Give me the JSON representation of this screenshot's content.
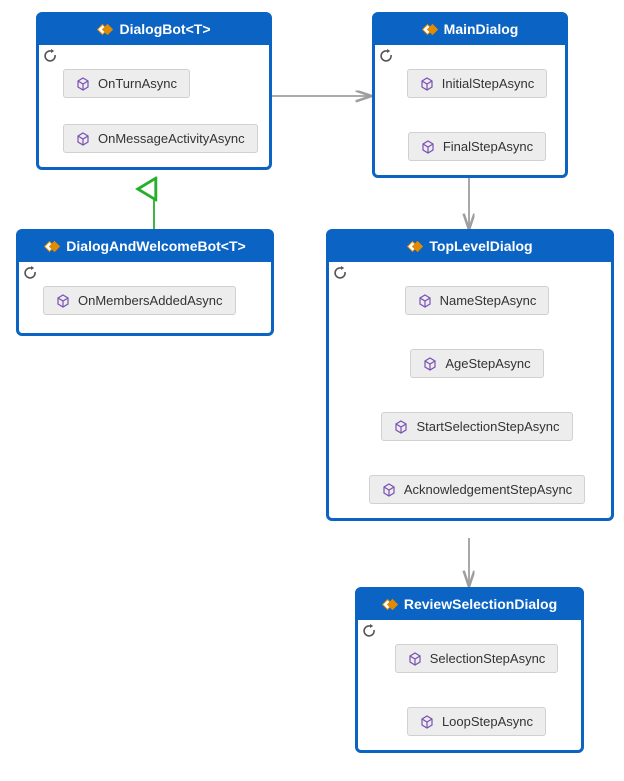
{
  "colors": {
    "primary": "#0b64c4",
    "method_bg": "#ededed",
    "method_border": "#d0d0d0",
    "arrow_gray": "#9e9e9e",
    "arrow_green": "#26b02a",
    "icon_orange": "#e38b00",
    "icon_purple": "#7a52b3"
  },
  "boxes": {
    "dialogBot": {
      "title": "DialogBot<T>",
      "methods": [
        "OnTurnAsync",
        "OnMessageActivityAsync"
      ]
    },
    "dialogAndWelcomeBot": {
      "title": "DialogAndWelcomeBot<T>",
      "methods": [
        "OnMembersAddedAsync"
      ]
    },
    "mainDialog": {
      "title": "MainDialog",
      "methods": [
        "InitialStepAsync",
        "FinalStepAsync"
      ]
    },
    "topLevelDialog": {
      "title": "TopLevelDialog",
      "methods": [
        "NameStepAsync",
        "AgeStepAsync",
        "StartSelectionStepAsync",
        "AcknowledgementStepAsync"
      ]
    },
    "reviewSelectionDialog": {
      "title": "ReviewSelectionDialog",
      "methods": [
        "SelectionStepAsync",
        "LoopStepAsync"
      ]
    }
  }
}
